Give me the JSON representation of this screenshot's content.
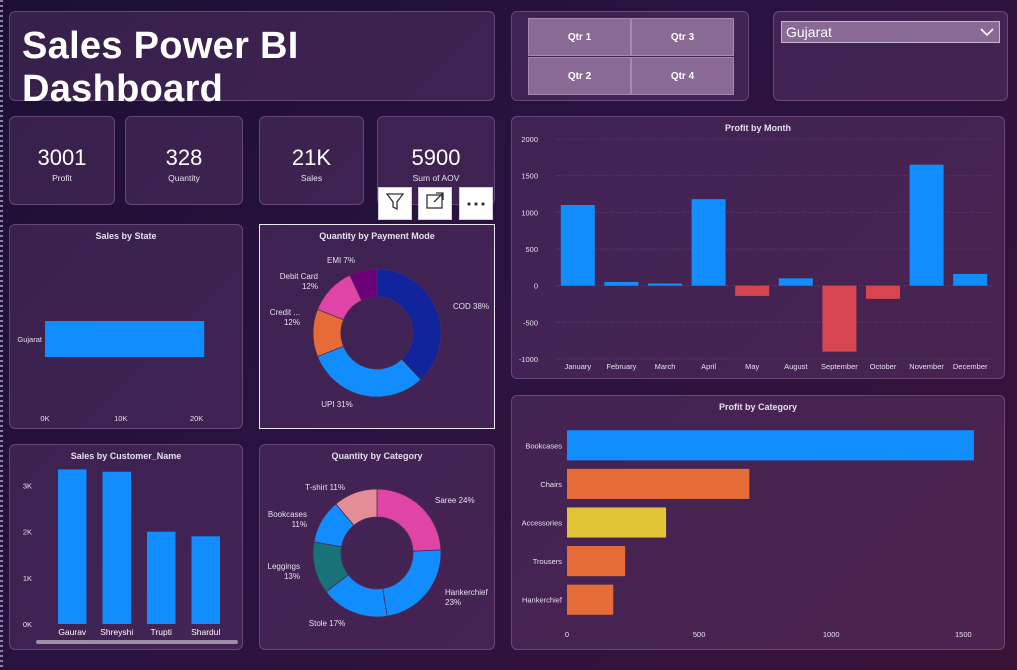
{
  "header": {
    "title": "Sales Power BI Dashboard"
  },
  "quarters": [
    "Qtr 1",
    "Qtr 3",
    "Qtr 2",
    "Qtr 4"
  ],
  "state_filter": {
    "selected": "Gujarat"
  },
  "kpis": [
    {
      "value": "3001",
      "label": "Profit"
    },
    {
      "value": "328",
      "label": "Quantity"
    },
    {
      "value": "21K",
      "label": "Sales"
    },
    {
      "value": "5900",
      "label": "Sum of AOV"
    }
  ],
  "visual_toolbar": {
    "icons": [
      "filter-icon",
      "focus-mode-icon",
      "more-options-icon"
    ]
  },
  "colors": {
    "blue": "#118dff",
    "red": "#d64550",
    "orange": "#e66c37",
    "yellow": "#e0c436",
    "navy": "#12239e",
    "pink": "#e044a7",
    "purple": "#6b007b",
    "teal": "#197278",
    "rose": "#e48d99"
  },
  "chart_data": [
    {
      "id": "sales_by_state",
      "type": "bar",
      "orientation": "horizontal",
      "title": "Sales by State",
      "categories": [
        "Gujarat"
      ],
      "values": [
        21000
      ],
      "xticks": [
        "0K",
        "10K",
        "20K"
      ],
      "xlim": [
        0,
        21500
      ]
    },
    {
      "id": "quantity_by_payment_mode",
      "type": "pie",
      "donut": true,
      "title": "Quantity by Payment Mode",
      "labels": [
        "COD 38%",
        "UPI 31%",
        "Credit ...\n12%",
        "Debit Card\n12%",
        "EMI 7%"
      ],
      "values": [
        38,
        31,
        12,
        12,
        7
      ],
      "colors": [
        "#12239e",
        "#118dff",
        "#e66c37",
        "#e044a7",
        "#6b007b"
      ]
    },
    {
      "id": "profit_by_month",
      "type": "bar",
      "title": "Profit by Month",
      "categories": [
        "January",
        "February",
        "March",
        "April",
        "May",
        "August",
        "September",
        "October",
        "November",
        "December"
      ],
      "values": [
        1100,
        50,
        30,
        1180,
        -140,
        100,
        -900,
        -180,
        1650,
        160
      ],
      "yticks": [
        "2000",
        "1500",
        "1000",
        "500",
        "0",
        "-500",
        "-1000"
      ],
      "ylim": [
        -1000,
        2000
      ]
    },
    {
      "id": "sales_by_customer_name",
      "type": "bar",
      "title": "Sales by Customer_Name",
      "categories": [
        "Gaurav",
        "Shreyshi",
        "Trupti",
        "Shardul"
      ],
      "values": [
        3350,
        3300,
        2000,
        1900
      ],
      "yticks": [
        "3K",
        "2K",
        "1K",
        "0K"
      ],
      "ylim": [
        0,
        3300
      ]
    },
    {
      "id": "quantity_by_category",
      "type": "pie",
      "donut": true,
      "title": "Quantity by Category",
      "labels": [
        "Saree 24%",
        "Hankerchief\n23%",
        "Stole 17%",
        "Leggings\n13%",
        "Bookcases\n11%",
        "T-shirt 11%"
      ],
      "values": [
        24,
        23,
        17,
        13,
        11,
        11
      ],
      "colors": [
        "#e044a7",
        "#118dff",
        "#118dff",
        "#197278",
        "#118dff",
        "#e48d99"
      ]
    },
    {
      "id": "profit_by_category",
      "type": "bar",
      "orientation": "horizontal",
      "title": "Profit by Category",
      "categories": [
        "Bookcases",
        "Chairs",
        "Accessories",
        "Trousers",
        "Hankerchief"
      ],
      "values": [
        1540,
        690,
        375,
        220,
        175
      ],
      "colors": [
        "#118dff",
        "#e66c37",
        "#e0c436",
        "#e66c37",
        "#e66c37"
      ],
      "xticks": [
        "0",
        "500",
        "1000",
        "1500"
      ],
      "xlim": [
        0,
        1650
      ]
    }
  ]
}
